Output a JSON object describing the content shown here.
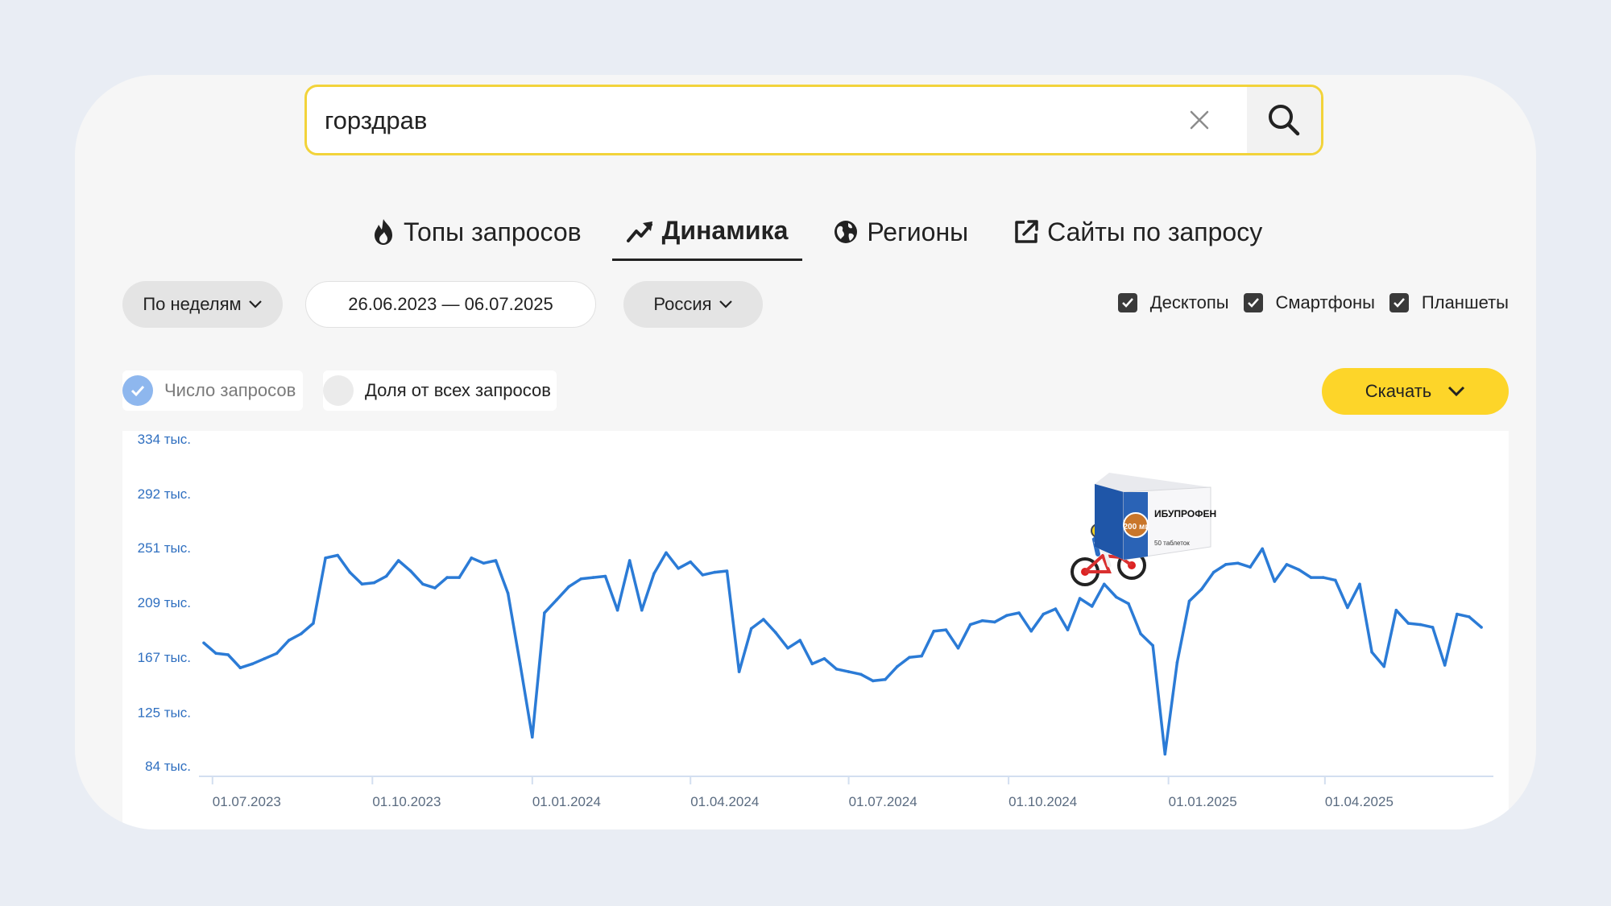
{
  "search": {
    "value": "горздрав",
    "clear_icon": "close-icon",
    "search_icon": "search-icon"
  },
  "tabs": [
    {
      "label": "Топы запросов",
      "icon": "fire-icon",
      "active": false
    },
    {
      "label": "Динамика",
      "icon": "trend-up-icon",
      "active": true
    },
    {
      "label": "Регионы",
      "icon": "globe-icon",
      "active": false
    },
    {
      "label": "Сайты по запросу",
      "icon": "external-link-icon",
      "active": false
    }
  ],
  "filters": {
    "period": "По неделям",
    "date_range": "26.06.2023 — 06.07.2025",
    "region": "Россия"
  },
  "devices": [
    {
      "label": "Десктопы",
      "checked": true
    },
    {
      "label": "Смартфоны",
      "checked": true
    },
    {
      "label": "Планшеты",
      "checked": true
    }
  ],
  "metrics": [
    {
      "label": "Число запросов",
      "selected": true
    },
    {
      "label": "Доля от всех запросов",
      "selected": false
    }
  ],
  "download_label": "Скачать",
  "colors": {
    "accent_yellow": "#fdd529",
    "line_blue": "#2b7bd6",
    "search_border": "#f2d33a"
  },
  "stickers": [
    {
      "kind": "bicycle-rider",
      "label": ""
    },
    {
      "kind": "medicine-box",
      "brand": "ИБУПРОФЕН",
      "dose": "200 мг",
      "count": "50 таблеток"
    }
  ],
  "chart_data": {
    "type": "line",
    "title": "",
    "xlabel": "",
    "ylabel": "",
    "ylim": [
      84,
      334
    ],
    "y_tick_labels": [
      "334 тыс.",
      "292 тыс.",
      "251 тыс.",
      "209 тыс.",
      "167 тыс.",
      "125 тыс.",
      "84 тыс."
    ],
    "y_tick_values": [
      334,
      292,
      251,
      209,
      167,
      125,
      84
    ],
    "x_tick_labels": [
      "01.07.2023",
      "01.10.2023",
      "01.01.2024",
      "01.04.2024",
      "01.07.2024",
      "01.10.2024",
      "01.01.2025",
      "01.04.2025"
    ],
    "x_tick_dates": [
      "2023-07-01",
      "2023-10-01",
      "2024-01-01",
      "2024-04-01",
      "2024-07-01",
      "2024-10-01",
      "2025-01-01",
      "2025-04-01"
    ],
    "x_range": [
      "2023-06-26",
      "2025-07-06"
    ],
    "grid": false,
    "series": [
      {
        "name": "",
        "x": [
          "2023-06-26",
          "2023-07-03",
          "2023-07-10",
          "2023-07-17",
          "2023-07-24",
          "2023-07-31",
          "2023-08-07",
          "2023-08-14",
          "2023-08-21",
          "2023-08-28",
          "2023-09-04",
          "2023-09-11",
          "2023-09-18",
          "2023-09-25",
          "2023-10-02",
          "2023-10-09",
          "2023-10-16",
          "2023-10-23",
          "2023-10-30",
          "2023-11-06",
          "2023-11-13",
          "2023-11-20",
          "2023-11-27",
          "2023-12-04",
          "2023-12-11",
          "2023-12-18",
          "2023-12-25",
          "2024-01-01",
          "2024-01-08",
          "2024-01-15",
          "2024-01-22",
          "2024-01-29",
          "2024-02-05",
          "2024-02-12",
          "2024-02-19",
          "2024-02-26",
          "2024-03-04",
          "2024-03-11",
          "2024-03-18",
          "2024-03-25",
          "2024-04-01",
          "2024-04-08",
          "2024-04-15",
          "2024-04-22",
          "2024-04-29",
          "2024-05-06",
          "2024-05-13",
          "2024-05-20",
          "2024-05-27",
          "2024-06-03",
          "2024-06-10",
          "2024-06-17",
          "2024-06-24",
          "2024-07-01",
          "2024-07-08",
          "2024-07-15",
          "2024-07-22",
          "2024-07-29",
          "2024-08-05",
          "2024-08-12",
          "2024-08-19",
          "2024-08-26",
          "2024-09-02",
          "2024-09-09",
          "2024-09-16",
          "2024-09-23",
          "2024-09-30",
          "2024-10-07",
          "2024-10-14",
          "2024-10-21",
          "2024-10-28",
          "2024-11-04",
          "2024-11-11",
          "2024-11-18",
          "2024-11-25",
          "2024-12-02",
          "2024-12-09",
          "2024-12-16",
          "2024-12-23",
          "2024-12-30",
          "2025-01-06",
          "2025-01-13",
          "2025-01-20",
          "2025-01-27",
          "2025-02-03",
          "2025-02-10",
          "2025-02-17",
          "2025-02-24",
          "2025-03-03",
          "2025-03-10",
          "2025-03-17",
          "2025-03-24",
          "2025-03-31",
          "2025-04-07",
          "2025-04-14",
          "2025-04-21",
          "2025-04-28",
          "2025-05-05",
          "2025-05-12",
          "2025-05-19",
          "2025-05-26",
          "2025-06-02",
          "2025-06-09",
          "2025-06-16",
          "2025-06-23",
          "2025-06-30"
        ],
        "values": [
          178,
          170,
          169,
          159,
          162,
          166,
          170,
          180,
          185,
          193,
          243,
          245,
          232,
          223,
          224,
          229,
          241,
          233,
          223,
          220,
          228,
          228,
          243,
          239,
          241,
          216,
          162,
          106,
          201,
          211,
          221,
          227,
          228,
          229,
          203,
          241,
          203,
          231,
          247,
          235,
          240,
          230,
          232,
          233,
          156,
          189,
          196,
          186,
          174,
          180,
          162,
          166,
          158,
          156,
          154,
          149,
          150,
          160,
          167,
          168,
          187,
          188,
          174,
          192,
          195,
          194,
          199,
          201,
          187,
          200,
          204,
          188,
          212,
          206,
          223,
          213,
          208,
          185,
          176,
          93,
          163,
          210,
          219,
          232,
          238,
          239,
          236,
          250,
          225,
          238,
          234,
          228,
          228,
          226,
          205,
          223,
          171,
          160,
          203,
          193,
          192,
          190,
          161,
          200,
          198,
          190
        ]
      }
    ]
  }
}
